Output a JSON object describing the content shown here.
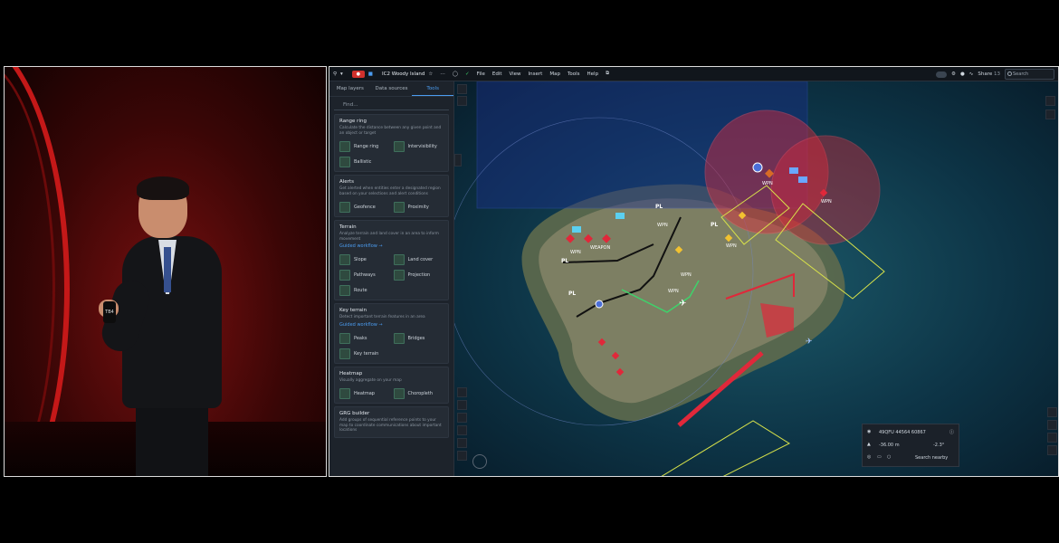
{
  "speaker": {
    "clicker_label": "TB4"
  },
  "app": {
    "topbar": {
      "rec_label": "●",
      "project_title": "IC2 Woody Island",
      "menu": [
        "File",
        "Edit",
        "View",
        "Insert",
        "Map",
        "Tools",
        "Help"
      ],
      "share_label": "Share",
      "share_count": "13",
      "search_placeholder": "Search"
    },
    "panel": {
      "tabs": [
        "Map layers",
        "Data sources",
        "Tools"
      ],
      "active_tab": "Tools",
      "find_placeholder": "Find...",
      "sections": [
        {
          "title": "Range ring",
          "desc": "Calculate the distance between any given point and an object or target",
          "workflow": "",
          "tools": [
            "Range ring",
            "Intervisibility",
            "Ballistic"
          ]
        },
        {
          "title": "Alerts",
          "desc": "Get alerted when entities enter a designated region based on your selections and alert conditions",
          "workflow": "",
          "tools": [
            "Geofence",
            "Proximity"
          ]
        },
        {
          "title": "Terrain",
          "desc": "Analyze terrain and land cover in an area to inform movement",
          "workflow": "Guided workflow →",
          "tools": [
            "Slope",
            "Land cover",
            "Pathways",
            "Projection",
            "Route"
          ]
        },
        {
          "title": "Key terrain",
          "desc": "Detect important terrain features in an area",
          "workflow": "Guided workflow →",
          "tools": [
            "Peaks",
            "Bridges",
            "Key terrain"
          ]
        },
        {
          "title": "Heatmap",
          "desc": "Visually aggregate on your map",
          "workflow": "",
          "tools": [
            "Heatmap",
            "Choropleth"
          ]
        },
        {
          "title": "GRG builder",
          "desc": "Add groups of sequential reference points to your map to coordinate communications about important locations",
          "workflow": "",
          "tools": []
        }
      ]
    },
    "map": {
      "labels": [
        "PL",
        "PL",
        "PL",
        "PL",
        "WPN",
        "WPN",
        "WPN",
        "WPN",
        "WPN",
        "WPN",
        "WPN",
        "WEAPON"
      ],
      "coord_readout": {
        "mgrs": "49QFU 44564 60867",
        "elevation": "-36.00 m",
        "bearing": "-2.3°",
        "search_nearby": "Search nearby"
      }
    },
    "colors": {
      "accent": "#4b9cf0",
      "threat_red": "#e0283a",
      "route_green": "#3ed36b",
      "zone_yellow": "#d8e24a"
    }
  }
}
